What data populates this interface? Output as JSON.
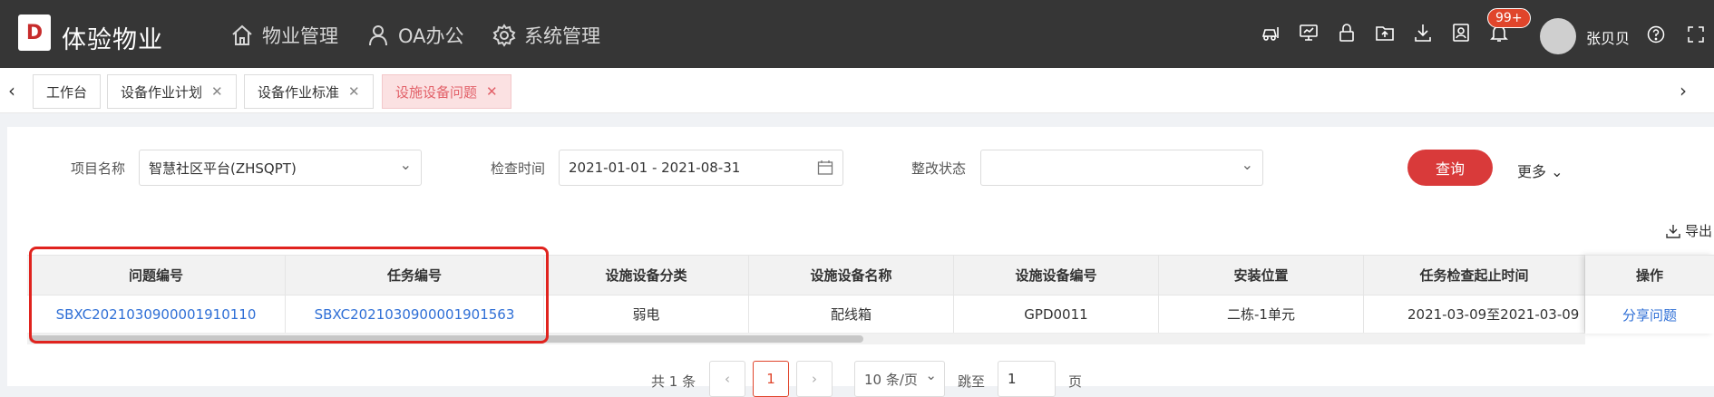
{
  "header": {
    "brand": "体验物业",
    "logo_letter": "D",
    "nav": [
      {
        "label": "物业管理",
        "icon": "home-icon"
      },
      {
        "label": "OA办公",
        "icon": "user-icon"
      },
      {
        "label": "系统管理",
        "icon": "gear-icon"
      }
    ],
    "tool_icons": [
      "car-icon",
      "monitor-icon",
      "lock-icon",
      "folder-upload-icon",
      "download-icon",
      "contact-icon",
      "bell-icon"
    ],
    "notification_badge": "99+",
    "username": "张贝贝",
    "accent_color": "#d93a3a"
  },
  "tabs": [
    {
      "label": "工作台",
      "closable": false
    },
    {
      "label": "设备作业计划",
      "closable": true
    },
    {
      "label": "设备作业标准",
      "closable": true
    },
    {
      "label": "设施设备问题",
      "closable": true,
      "active": true
    }
  ],
  "filters": {
    "project_label": "项目名称",
    "project_value": "智慧社区平台(ZHSQPT)",
    "date_label": "检查时间",
    "date_value": "2021-01-01 - 2021-08-31",
    "status_label": "整改状态",
    "status_value": "",
    "query_button": "查询",
    "more_button": "更多",
    "export_button": "导出"
  },
  "table": {
    "columns": [
      "问题编号",
      "任务编号",
      "设施设备分类",
      "设施设备名称",
      "设施设备编号",
      "安装位置",
      "任务检查起止时间",
      "操作"
    ],
    "rows": [
      {
        "problem_no": "SBXC202103090000191011​0",
        "task_no": "SBXC2021030900001901563",
        "category": "弱电",
        "name": "配线箱",
        "code": "GPD0011",
        "location": "二栋-1单元",
        "period": "2021-03-09至2021-03-09",
        "action": "分享问题"
      }
    ]
  },
  "pagination": {
    "total": "共 1 条",
    "current": "1",
    "page_size": "10 条/页",
    "jump_label": "跳至",
    "jump_value": "1",
    "page_suffix": "页"
  }
}
